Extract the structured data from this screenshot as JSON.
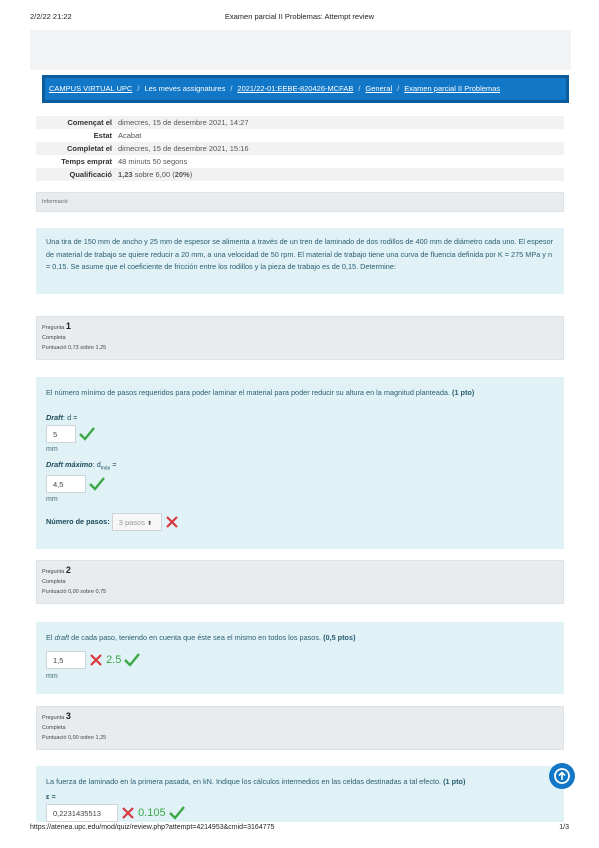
{
  "print_header": {
    "date": "2/2/22 21:22",
    "title": "Examen parcial II Problemas: Attempt review"
  },
  "print_footer": {
    "url": "https://atenea.upc.edu/mod/quiz/review.php?attempt=4214953&cmid=3164775",
    "pages": "1/3"
  },
  "breadcrumb": {
    "items": [
      "CAMPUS VIRTUAL UPC",
      "Les meves assignatures",
      "2021/22-01:EEBE-820426-MCFAB",
      "General",
      "Examen parcial II Problemas"
    ],
    "separator": "/"
  },
  "summary": [
    {
      "key": "Començat el",
      "value": "dimecres, 15 de desembre 2021, 14:27"
    },
    {
      "key": "Estat",
      "value": "Acabat"
    },
    {
      "key": "Completat el",
      "value": "dimecres, 15 de desembre 2021, 15:16"
    },
    {
      "key": "Temps emprat",
      "value": "48 minuts 50 segons"
    },
    {
      "key": "Qualificació",
      "value_bold": "1,23",
      "value_rest": " sobre 6,00 (",
      "value_pct": "20%",
      "value_end": ")"
    }
  ],
  "info": {
    "label": "Informació",
    "text": "Una tira de 150 mm de ancho y 25 mm de espesor se alimenta a través de un tren de laminado de dos rodillos de 400 mm de diámetro cada uno. El espesor de material de trabajo se quiere reducir a 20 mm, a una velocidad de 50 rpm. El material de trabajo tiene una curva de fluencia definida por K = 275 MPa y n = 0,15. Se asume que el coeficiente de fricción entre los rodillos y la pieza de trabajo es de 0,15. Determine:"
  },
  "questions": [
    {
      "label": "Pregunta",
      "number": "1",
      "state": "Completa",
      "score": "Puntuació 0,73 sobre 1,25",
      "prompt": "El número mínimo de pasos requeridos para poder laminar el material para poder reducir su altura en la magnitud planteada. ",
      "points": "(1 pto)",
      "draft_label": "Draft",
      "draft_suffix": ": d =",
      "draft_value": "5",
      "unit": "mm",
      "draftmax_label": "Draft máximo",
      "draftmax_suffix": ": d",
      "draftmax_sub": "máx",
      "draftmax_eq": " =",
      "draftmax_value": "4,5",
      "steps_label": "Número de pasos:",
      "steps_value": "3 pasos"
    },
    {
      "label": "Pregunta",
      "number": "2",
      "state": "Completa",
      "score": "Puntuació 0,00 sobre 0,75",
      "prompt_pre": "El ",
      "prompt_em": "draft",
      "prompt_post": " de cada paso, teniendo en cuenta que éste sea el mismo en todos los pasos. ",
      "points": "(0,5 ptos)",
      "value": "1,5",
      "correct": "2.5",
      "unit": "mm"
    },
    {
      "label": "Pregunta",
      "number": "3",
      "state": "Completa",
      "score": "Puntuació 0,00 sobre 1,25",
      "prompt": "La fuerza de laminado en la primera pasada, en kN. Indique los cálculos intermedios en las celdas destinadas a tal efecto. ",
      "points": "(1 pto)",
      "epsilon_label": "ε =",
      "value": "0,2231435513",
      "correct": "0.105"
    }
  ],
  "colors": {
    "accent": "#1177c6",
    "correct": "#3aa845",
    "incorrect": "#d9363e",
    "info_bg": "#e1f2f7"
  }
}
